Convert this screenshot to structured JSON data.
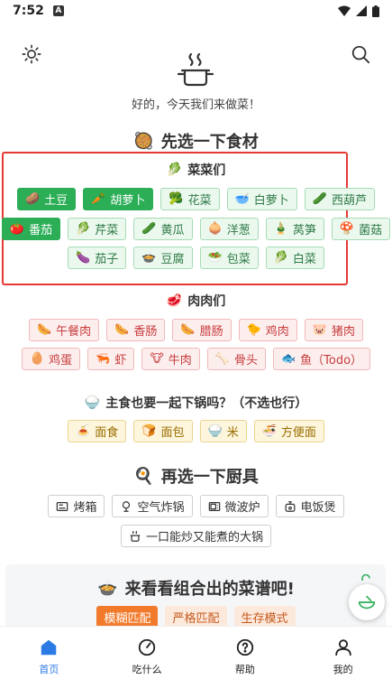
{
  "status": {
    "time": "7:52",
    "badge": "A"
  },
  "header": {
    "greeting": "好的，今天我们来做菜！"
  },
  "step1": {
    "title": "先选一下食材",
    "veg_title": "菜菜们",
    "veg": [
      [
        {
          "emoji": "🥔",
          "label": "土豆",
          "selected": true
        },
        {
          "emoji": "🥕",
          "label": "胡萝卜",
          "selected": true
        },
        {
          "emoji": "🥦",
          "label": "花菜",
          "selected": false
        },
        {
          "emoji": "🥣",
          "label": "白萝卜",
          "selected": false
        },
        {
          "emoji": "🥒",
          "label": "西葫芦",
          "selected": false
        }
      ],
      [
        {
          "emoji": "🍅",
          "label": "番茄",
          "selected": true
        },
        {
          "emoji": "🥬",
          "label": "芹菜",
          "selected": false
        },
        {
          "emoji": "🥒",
          "label": "黄瓜",
          "selected": false
        },
        {
          "emoji": "🧅",
          "label": "洋葱",
          "selected": false
        },
        {
          "emoji": "🎍",
          "label": "莴笋",
          "selected": false
        },
        {
          "emoji": "🍄",
          "label": "菌菇",
          "selected": false
        }
      ],
      [
        {
          "emoji": "🍆",
          "label": "茄子",
          "selected": false
        },
        {
          "emoji": "🍲",
          "label": "豆腐",
          "selected": false
        },
        {
          "emoji": "🥗",
          "label": "包菜",
          "selected": false
        },
        {
          "emoji": "🥬",
          "label": "白菜",
          "selected": false
        }
      ]
    ],
    "meat_title": "肉肉们",
    "meat": [
      [
        {
          "emoji": "🌭",
          "label": "午餐肉"
        },
        {
          "emoji": "🌭",
          "label": "香肠"
        },
        {
          "emoji": "🌭",
          "label": "腊肠"
        },
        {
          "emoji": "🐤",
          "label": "鸡肉"
        },
        {
          "emoji": "🐷",
          "label": "猪肉"
        }
      ],
      [
        {
          "emoji": "🥚",
          "label": "鸡蛋"
        },
        {
          "emoji": "🦐",
          "label": "虾"
        },
        {
          "emoji": "🐮",
          "label": "牛肉"
        },
        {
          "emoji": "🦴",
          "label": "骨头"
        },
        {
          "emoji": "🐟",
          "label": "鱼（Todo）"
        }
      ]
    ],
    "staple_title": "主食也要一起下锅吗？（不选也行）",
    "staple": [
      {
        "emoji": "🍝",
        "label": "面食"
      },
      {
        "emoji": "🍞",
        "label": "面包"
      },
      {
        "emoji": "🍚",
        "label": "米"
      },
      {
        "emoji": "🍜",
        "label": "方便面"
      }
    ]
  },
  "step2": {
    "title": "再选一下厨具",
    "tools": [
      [
        {
          "icon": "oven-icon",
          "label": "烤箱"
        },
        {
          "icon": "air-fryer-icon",
          "label": "空气炸锅"
        },
        {
          "icon": "microwave-icon",
          "label": "微波炉"
        },
        {
          "icon": "rice-cooker-icon",
          "label": "电饭煲"
        }
      ],
      [
        {
          "icon": "pot-icon",
          "label": "一口能炒又能煮的大锅"
        }
      ]
    ]
  },
  "result": {
    "title": "来看看组合出的菜谱吧!",
    "modes": [
      {
        "label": "模糊匹配",
        "selected": true
      },
      {
        "label": "严格匹配",
        "selected": false
      },
      {
        "label": "生存模式",
        "selected": false
      }
    ]
  },
  "nav": [
    {
      "label": "首页",
      "icon": "home-icon",
      "active": true
    },
    {
      "label": "吃什么",
      "icon": "dial-icon",
      "active": false
    },
    {
      "label": "帮助",
      "icon": "help-icon",
      "active": false
    },
    {
      "label": "我的",
      "icon": "user-icon",
      "active": false
    }
  ],
  "colors": {
    "accent": "#2c7be5",
    "veg_selected": "#2bae56",
    "mode_selected": "#f27a2c",
    "highlight_box": "#e53935"
  }
}
